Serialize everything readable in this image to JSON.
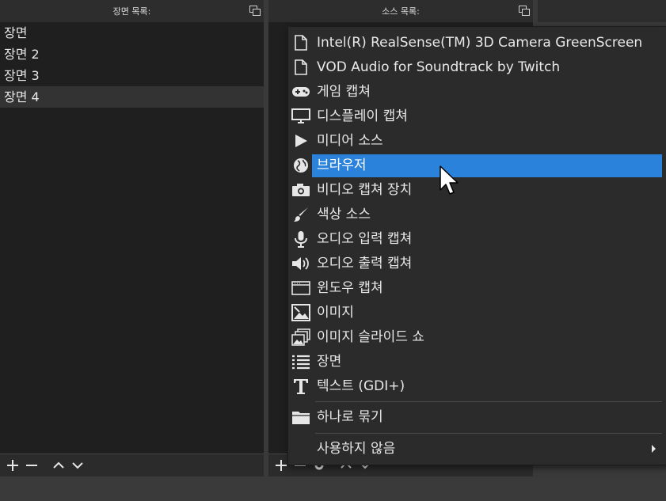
{
  "scenes_dock": {
    "title": "장면 목록:",
    "items": [
      {
        "label": "장면"
      },
      {
        "label": "장면 2"
      },
      {
        "label": "장면 3"
      },
      {
        "label": "장면 4"
      }
    ],
    "selected_index": 3
  },
  "sources_dock": {
    "title": "소스 목록:"
  },
  "add_source_menu": {
    "items": [
      {
        "label": "Intel(R) RealSense(TM) 3D Camera GreenScreen",
        "icon": "file-icon"
      },
      {
        "label": "VOD Audio for Soundtrack by Twitch",
        "icon": "file-icon"
      },
      {
        "label": "게임 캡쳐",
        "icon": "gamepad-icon"
      },
      {
        "label": "디스플레이 캡쳐",
        "icon": "monitor-icon"
      },
      {
        "label": "미디어 소스",
        "icon": "play-icon"
      },
      {
        "label": "브라우저",
        "icon": "globe-icon"
      },
      {
        "label": "비디오 캡쳐 장치",
        "icon": "camera-icon"
      },
      {
        "label": "색상 소스",
        "icon": "brush-icon"
      },
      {
        "label": "오디오 입력 캡쳐",
        "icon": "microphone-icon"
      },
      {
        "label": "오디오 출력 캡쳐",
        "icon": "speaker-icon"
      },
      {
        "label": "윈도우 캡쳐",
        "icon": "window-icon"
      },
      {
        "label": "이미지",
        "icon": "image-icon"
      },
      {
        "label": "이미지 슬라이드 쇼",
        "icon": "slideshow-icon"
      },
      {
        "label": "장면",
        "icon": "list-icon"
      },
      {
        "label": "텍스트 (GDI+)",
        "icon": "text-icon"
      }
    ],
    "group_item": {
      "label": "하나로 묶기",
      "icon": "folder-icon"
    },
    "deprecated_item": {
      "label": "사용하지 않음"
    },
    "highlighted_index": 5,
    "highlight_color": "#2a82da"
  },
  "toolbar": {
    "add": "+",
    "remove": "−"
  }
}
